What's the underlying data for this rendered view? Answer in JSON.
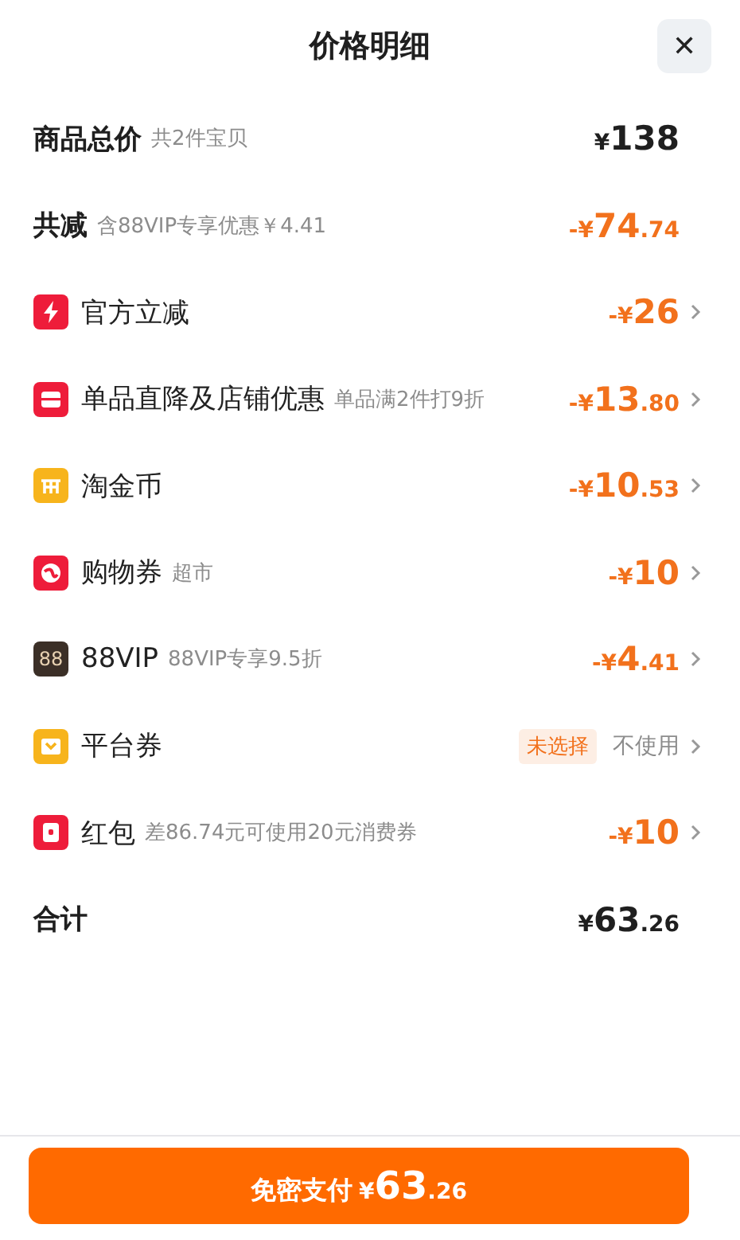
{
  "title": "价格明细",
  "close": "✕",
  "summary": [
    {
      "label": "商品总价",
      "note": "共2件宝贝",
      "amount": {
        "prefix": "¥",
        "main": "138"
      },
      "discount": false
    },
    {
      "label": "共减",
      "note": "含88VIP专享优惠￥4.41",
      "amount": {
        "prefix": "-¥",
        "main": "74",
        "cents": ".74"
      },
      "discount": true
    }
  ],
  "items": [
    {
      "kind": "amount",
      "label": "官方立减",
      "amount": {
        "prefix": "-¥",
        "main": "26"
      }
    },
    {
      "kind": "amount",
      "label": "单品直降及店铺优惠",
      "note": "单品满2件打9折",
      "amount": {
        "prefix": "-¥",
        "main": "13",
        "cents": ".80"
      }
    },
    {
      "kind": "amount",
      "label": "淘金币",
      "amount": {
        "prefix": "-¥",
        "main": "10",
        "cents": ".53"
      }
    },
    {
      "kind": "amount",
      "label": "购物券",
      "note": "超市",
      "amount": {
        "prefix": "-¥",
        "main": "10"
      }
    },
    {
      "kind": "amount",
      "label": "88VIP",
      "icon_text": "88",
      "note": "88VIP专享9.5折",
      "amount": {
        "prefix": "-¥",
        "main": "4",
        "cents": ".41"
      }
    },
    {
      "kind": "option",
      "label": "平台券",
      "tag": "未选择",
      "status": "不使用"
    },
    {
      "kind": "amount",
      "label": "红包",
      "note": "差86.74元可使用20元消费券",
      "amount": {
        "prefix": "-¥",
        "main": "10"
      }
    }
  ],
  "total": {
    "label": "合计",
    "amount": {
      "prefix": "¥",
      "main": "63",
      "cents": ".26"
    }
  },
  "pay_button": {
    "label": "免密支付",
    "amount": {
      "prefix": "¥",
      "main": "63",
      "cents": ".26"
    }
  }
}
